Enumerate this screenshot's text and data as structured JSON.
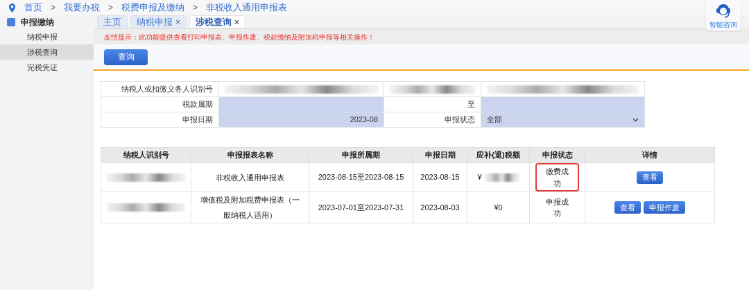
{
  "breadcrumb": [
    "首页",
    "我要办税",
    "税费申报及缴纳",
    "非税收入通用申报表"
  ],
  "breadcrumb_separator": ">",
  "tab_close_glyph": "×",
  "assistant": {
    "label": "智能咨询"
  },
  "sidebar": {
    "title": "申报缴纳",
    "items": [
      {
        "label": "纳税申报",
        "selected": false
      },
      {
        "label": "涉税查询",
        "selected": true
      },
      {
        "label": "完税凭证",
        "selected": false
      }
    ]
  },
  "tabs": [
    {
      "label": "主页",
      "selected": false,
      "closable": false
    },
    {
      "label": "纳税申报",
      "selected": false,
      "closable": true
    },
    {
      "label": "涉税查询",
      "selected": true,
      "closable": true
    }
  ],
  "notice": "友情提示：此功能提供查看打印申报表、申报作废、税款缴纳及附加税申报等相关操作！",
  "query_button": "查询",
  "form": {
    "rows": [
      {
        "label": "纳税人或扣缴义务人识别号",
        "value_redacted": true,
        "label_2_redacted": true,
        "value_2_redacted": true
      },
      {
        "label": "税款属期",
        "value": "",
        "label_2": "至",
        "value_2": ""
      },
      {
        "label": "申报日期",
        "value": "2023-08",
        "label_2": "申报状态",
        "select": "全部"
      }
    ]
  },
  "table": {
    "columns": [
      "纳税人识别号",
      "申报报表名称",
      "申报所属期",
      "申报日期",
      "应补(退)税额",
      "申报状态",
      "详情"
    ],
    "rows": [
      {
        "taxpayer_redacted": true,
        "form_name": "非税收入通用申报表",
        "period": "2023-08-15至2023-08-15",
        "date": "2023-08-15",
        "amount": "¥",
        "amount_redacted": true,
        "status": "缴费成功",
        "highlighted": true,
        "actions": [
          "查看"
        ]
      },
      {
        "taxpayer_redacted": true,
        "form_name": "增值税及附加税费申报表（一般纳税人适用）",
        "period": "2023-07-01至2023-07-31",
        "date": "2023-08-03",
        "amount": "¥0",
        "amount_redacted": false,
        "status": "申报成功",
        "highlighted": false,
        "actions": [
          "查看",
          "申报作废"
        ]
      }
    ]
  }
}
